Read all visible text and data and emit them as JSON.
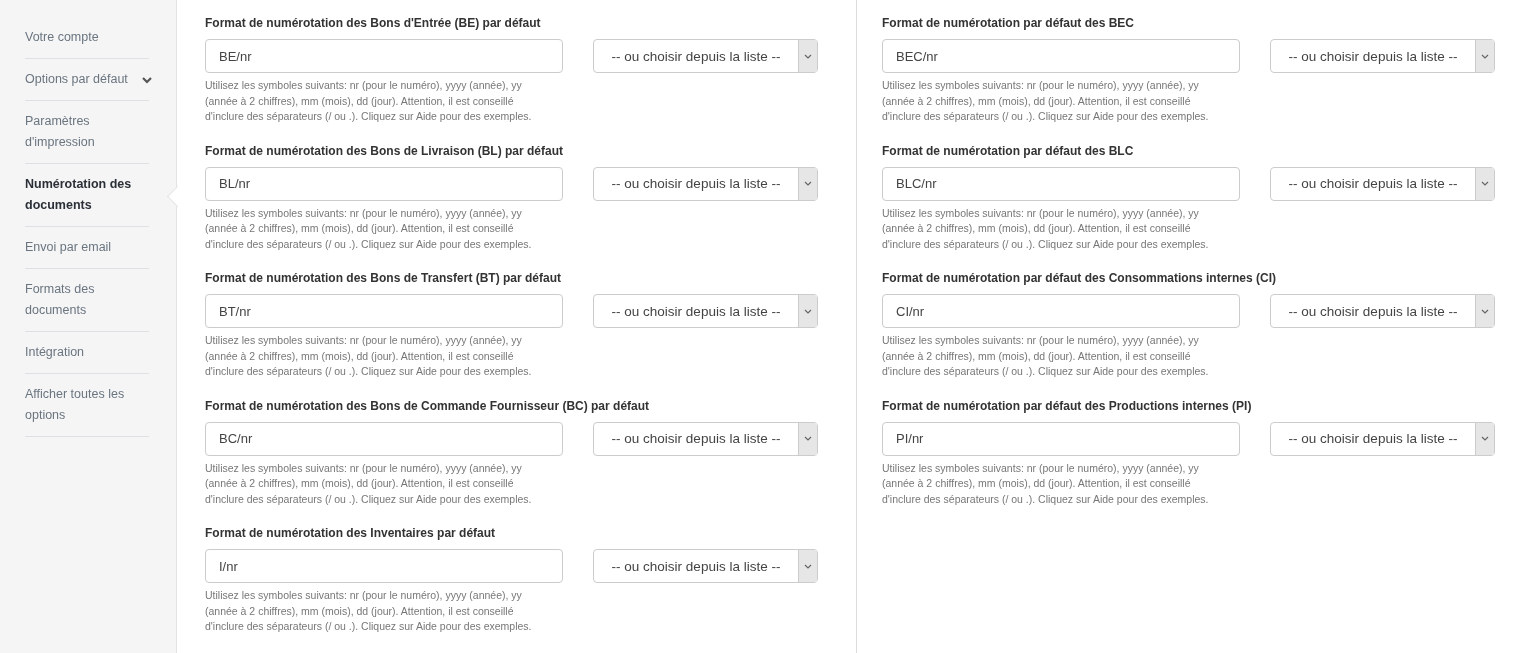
{
  "sidebar": {
    "items": [
      {
        "label": "Votre compte",
        "kind": "link",
        "selected": false
      },
      {
        "label": "Options par défaut",
        "kind": "dropdown",
        "selected": false
      },
      {
        "label": "Paramètres d'impression",
        "kind": "link",
        "selected": false
      },
      {
        "label": "Numérotation des documents",
        "kind": "link",
        "selected": true
      },
      {
        "label": "Envoi par email",
        "kind": "link",
        "selected": false
      },
      {
        "label": "Formats des documents",
        "kind": "link",
        "selected": false
      },
      {
        "label": "Intégration",
        "kind": "link",
        "selected": false
      },
      {
        "label": "Afficher toutes les options",
        "kind": "link",
        "selected": false
      }
    ]
  },
  "columns": [
    {
      "fields": [
        {
          "label": "Format de numérotation des Bons d'Entrée (BE) par défaut",
          "value": "BE/nr",
          "select": "-- ou choisir depuis la liste --",
          "hint": "Utilisez les symboles suivants: nr (pour le numéro), yyyy (année), yy (année à 2 chiffres), mm (mois), dd (jour). Attention, il est conseillé d'inclure des séparateurs (/ ou .). Cliquez sur Aide pour des exemples."
        },
        {
          "label": "Format de numérotation des Bons de Livraison (BL) par défaut",
          "value": "BL/nr",
          "select": "-- ou choisir depuis la liste --",
          "hint": "Utilisez les symboles suivants: nr (pour le numéro), yyyy (année), yy (année à 2 chiffres), mm (mois), dd (jour). Attention, il est conseillé d'inclure des séparateurs (/ ou .). Cliquez sur Aide pour des exemples."
        },
        {
          "label": "Format de numérotation des Bons de Transfert (BT) par défaut",
          "value": "BT/nr",
          "select": "-- ou choisir depuis la liste --",
          "hint": "Utilisez les symboles suivants: nr (pour le numéro), yyyy (année), yy (année à 2 chiffres), mm (mois), dd (jour). Attention, il est conseillé d'inclure des séparateurs (/ ou .). Cliquez sur Aide pour des exemples."
        },
        {
          "label": "Format de numérotation des Bons de Commande Fournisseur (BC) par défaut",
          "value": "BC/nr",
          "select": "-- ou choisir depuis la liste --",
          "hint": "Utilisez les symboles suivants: nr (pour le numéro), yyyy (année), yy (année à 2 chiffres), mm (mois), dd (jour). Attention, il est conseillé d'inclure des séparateurs (/ ou .). Cliquez sur Aide pour des exemples."
        },
        {
          "label": "Format de numérotation des Inventaires par défaut",
          "value": "I/nr",
          "select": "-- ou choisir depuis la liste --",
          "hint": "Utilisez les symboles suivants: nr (pour le numéro), yyyy (année), yy (année à 2 chiffres), mm (mois), dd (jour). Attention, il est conseillé d'inclure des séparateurs (/ ou .). Cliquez sur Aide pour des exemples."
        }
      ]
    },
    {
      "fields": [
        {
          "label": "Format de numérotation par défaut des BEC",
          "value": "BEC/nr",
          "select": "-- ou choisir depuis la liste --",
          "hint": "Utilisez les symboles suivants: nr (pour le numéro), yyyy (année), yy (année à 2 chiffres), mm (mois), dd (jour). Attention, il est conseillé d'inclure des séparateurs (/ ou .). Cliquez sur Aide pour des exemples."
        },
        {
          "label": "Format de numérotation par défaut des BLC",
          "value": "BLC/nr",
          "select": "-- ou choisir depuis la liste --",
          "hint": "Utilisez les symboles suivants: nr (pour le numéro), yyyy (année), yy (année à 2 chiffres), mm (mois), dd (jour). Attention, il est conseillé d'inclure des séparateurs (/ ou .). Cliquez sur Aide pour des exemples."
        },
        {
          "label": "Format de numérotation par défaut des Consommations internes (CI)",
          "value": "CI/nr",
          "select": "-- ou choisir depuis la liste --",
          "hint": "Utilisez les symboles suivants: nr (pour le numéro), yyyy (année), yy (année à 2 chiffres), mm (mois), dd (jour). Attention, il est conseillé d'inclure des séparateurs (/ ou .). Cliquez sur Aide pour des exemples."
        },
        {
          "label": "Format de numérotation par défaut des Productions internes (PI)",
          "value": "PI/nr",
          "select": "-- ou choisir depuis la liste --",
          "hint": "Utilisez les symboles suivants: nr (pour le numéro), yyyy (année), yy (année à 2 chiffres), mm (mois), dd (jour). Attention, il est conseillé d'inclure des séparateurs (/ ou .). Cliquez sur Aide pour des exemples."
        }
      ]
    }
  ]
}
